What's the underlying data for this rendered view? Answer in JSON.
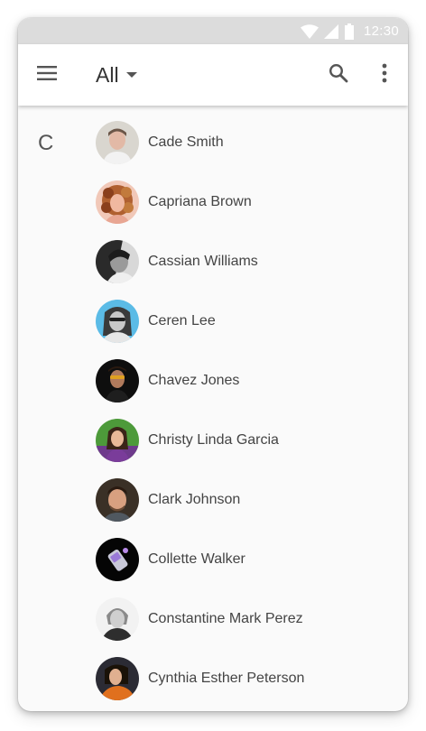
{
  "status_bar": {
    "time": "12:30",
    "icons": [
      "wifi-icon",
      "cell-signal-icon",
      "battery-icon"
    ]
  },
  "app_bar": {
    "title": "All",
    "icons": [
      "menu-icon",
      "dropdown-arrow-icon",
      "search-icon",
      "more-vert-icon"
    ]
  },
  "contacts": {
    "section_letter": "C",
    "items": [
      {
        "name": "Cade Smith"
      },
      {
        "name": "Capriana Brown"
      },
      {
        "name": "Cassian Williams"
      },
      {
        "name": "Ceren Lee"
      },
      {
        "name": "Chavez Jones"
      },
      {
        "name": "Christy Linda Garcia"
      },
      {
        "name": "Clark Johnson"
      },
      {
        "name": "Collette Walker"
      },
      {
        "name": "Constantine Mark Perez"
      },
      {
        "name": "Cynthia Esther Peterson"
      }
    ]
  },
  "colors": {
    "status_bar": "#dcdcdc",
    "app_bar": "#ffffff",
    "background": "#fafafa",
    "text_primary": "#444444",
    "icon": "#555555"
  }
}
